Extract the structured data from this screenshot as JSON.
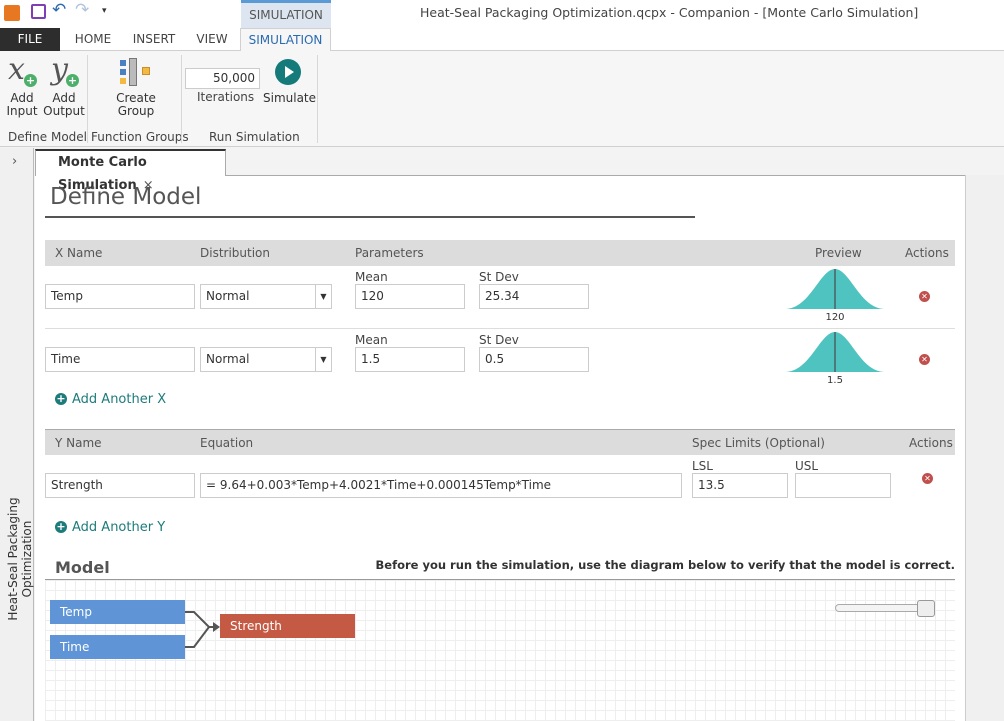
{
  "window": {
    "title": "Heat-Seal Packaging Optimization.qcpx - Companion - [Monte Carlo Simulation]",
    "context_tab": "SIMULATION"
  },
  "tabs": [
    "FILE",
    "HOME",
    "INSERT",
    "VIEW",
    "SIMULATION"
  ],
  "ribbon": {
    "add_input": [
      "Add",
      "Input"
    ],
    "add_output": [
      "Add",
      "Output"
    ],
    "define_model": "Define Model",
    "create_group": [
      "Create",
      "Group"
    ],
    "function_groups": "Function Groups",
    "iterations_value": "50,000",
    "iterations_label": "Iterations",
    "simulate": "Simulate",
    "run_simulation": "Run Simulation"
  },
  "sidebar": {
    "project": "Heat-Seal Packaging Optimization"
  },
  "doc_tab": {
    "label": "Monte Carlo Simulation",
    "close": "×"
  },
  "page_title": "Define Model",
  "x_table": {
    "headers": {
      "name": "X Name",
      "distribution": "Distribution",
      "parameters": "Parameters",
      "preview": "Preview",
      "actions": "Actions"
    },
    "rows": [
      {
        "name": "Temp",
        "distribution": "Normal",
        "p1_label": "Mean",
        "p1": "120",
        "p2_label": "St Dev",
        "p2": "25.34",
        "preview_label": "120"
      },
      {
        "name": "Time",
        "distribution": "Normal",
        "p1_label": "Mean",
        "p1": "1.5",
        "p2_label": "St Dev",
        "p2": "0.5",
        "preview_label": "1.5"
      }
    ],
    "add": "Add Another X"
  },
  "y_table": {
    "headers": {
      "name": "Y Name",
      "equation": "Equation",
      "spec": "Spec Limits (Optional)",
      "actions": "Actions"
    },
    "rows": [
      {
        "name": "Strength",
        "equation": "=  9.64+0.003*Temp+4.0021*Time+0.000145Temp*Time",
        "lsl_label": "LSL",
        "lsl": "13.5",
        "usl_label": "USL",
        "usl": ""
      }
    ],
    "add": "Add Another Y"
  },
  "model": {
    "title": "Model",
    "hint": "Before you run the simulation, use the diagram below to verify that the model is correct.",
    "inputs": [
      "Temp",
      "Time"
    ],
    "output": "Strength",
    "zoom_level": 1.0
  },
  "colors": {
    "input_node": "#5f95d6",
    "output_node": "#c55a44",
    "accent": "#1e7b7b",
    "preview": "#4fc3c0"
  }
}
